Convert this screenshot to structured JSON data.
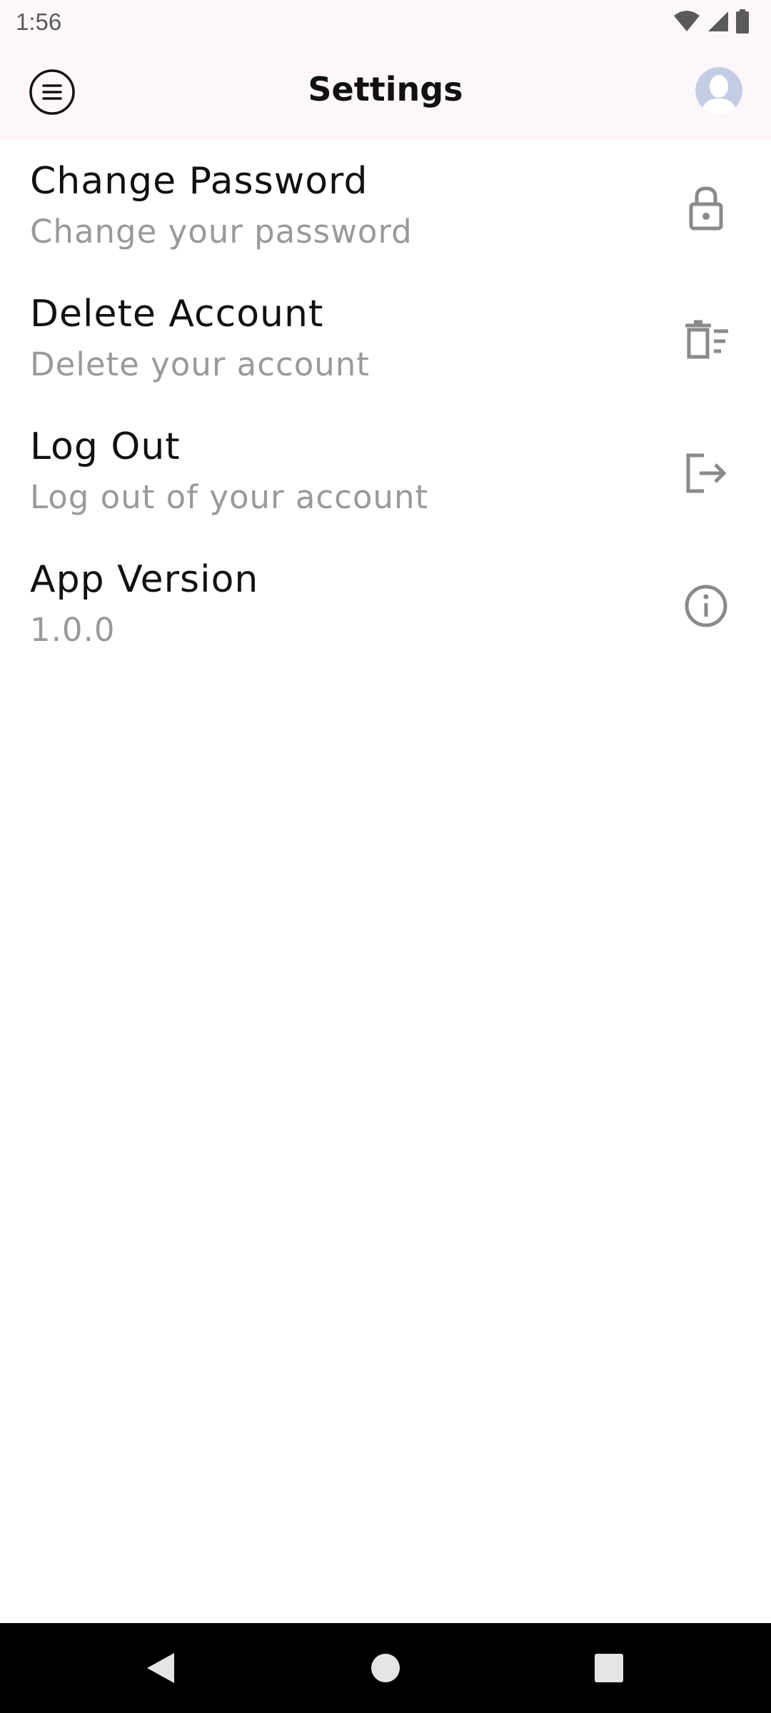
{
  "status_bar": {
    "time": "1:56",
    "icons": [
      "wifi-icon",
      "signal-icon",
      "battery-icon"
    ]
  },
  "app_bar": {
    "title": "Settings",
    "menu_icon": "menu-icon",
    "avatar_icon": "avatar"
  },
  "settings": {
    "items": [
      {
        "title": "Change Password",
        "subtitle": "Change your password",
        "icon": "lock-icon"
      },
      {
        "title": "Delete Account",
        "subtitle": "Delete your account",
        "icon": "delete-icon"
      },
      {
        "title": "Log Out",
        "subtitle": "Log out of your account",
        "icon": "logout-icon"
      },
      {
        "title": "App Version",
        "subtitle": "1.0.0",
        "icon": "info-icon"
      }
    ]
  },
  "nav_bar": {
    "buttons": [
      "back-icon",
      "home-icon",
      "recents-icon"
    ]
  },
  "colors": {
    "app_bar_bg": "#fdf7fc",
    "title_text": "#111111",
    "subtitle_text": "#9a9a9a",
    "icon_gray": "#8a8a8a",
    "avatar": "#c4cde3",
    "nav_bar_bg": "#000000"
  }
}
